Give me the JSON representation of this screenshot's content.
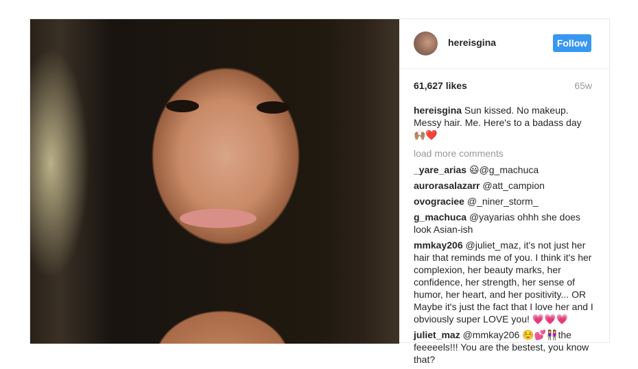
{
  "header": {
    "username": "hereisgina",
    "follow_label": "Follow"
  },
  "stats": {
    "likes": "61,627 likes",
    "age": "65w"
  },
  "caption": {
    "user": "hereisgina",
    "text": "Sun kissed. No makeup. Messy hair. Me. Here's to a badass day",
    "emoji": "🙌🏽❤️"
  },
  "load_more": "load more comments",
  "comments": [
    {
      "user": "_yare_arias",
      "text": "😃@g_machuca"
    },
    {
      "user": "aurorasalazarr",
      "text": "@att_campion"
    },
    {
      "user": "ovograciee",
      "text": "@_niner_storm_"
    },
    {
      "user": "g_machuca",
      "text": "@yayarias ohhh she does look Asian-ish"
    },
    {
      "user": "mmkay206",
      "text": "@juliet_maz, it's not just her hair that reminds me of you. I think it's her complexion, her beauty marks, her confidence, her strength, her sense of humor, her heart, and her positivity... OR Maybe it's just the fact that I love her and I obviously super LOVE you! 💗💗💗"
    },
    {
      "user": "juliet_maz",
      "text": "@mmkay206 ☺️💕👭the feeeeels!!! You are the bestest, you know that?"
    }
  ]
}
